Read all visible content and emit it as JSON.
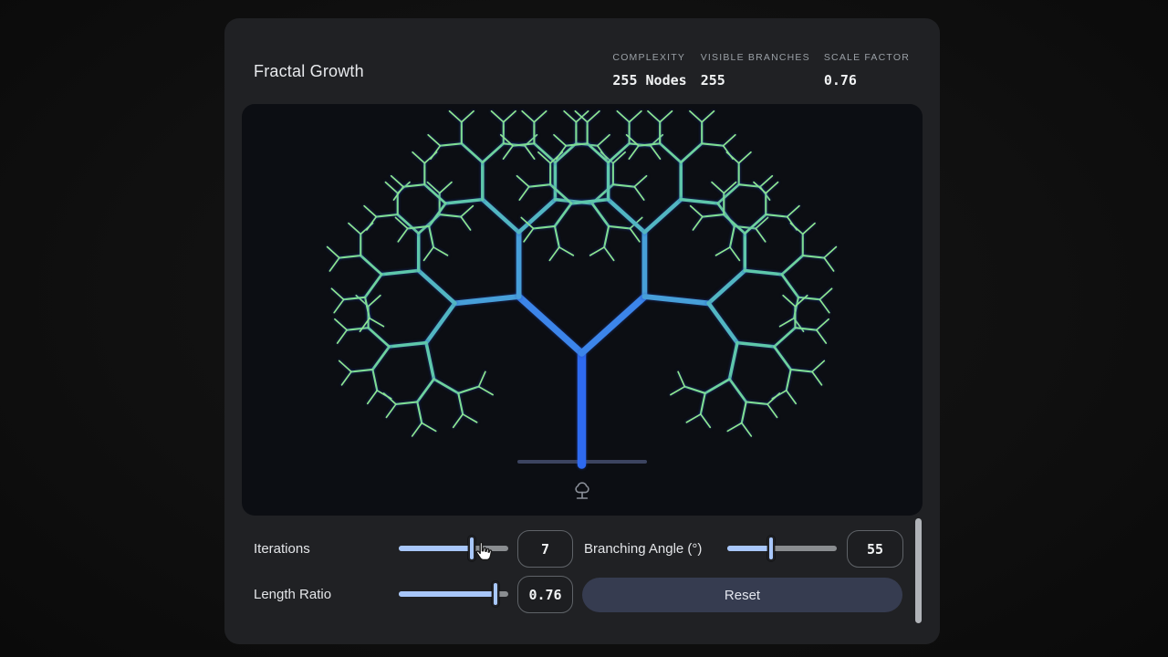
{
  "header": {
    "title": "Fractal Growth",
    "stats": [
      {
        "label": "COMPLEXITY",
        "value": "255 Nodes"
      },
      {
        "label": "VISIBLE BRANCHES",
        "value": "255"
      },
      {
        "label": "SCALE FACTOR",
        "value": "0.76"
      }
    ]
  },
  "tree": {
    "iterations": 7,
    "branching_angle_deg": 55,
    "length_ratio": 0.76,
    "complexity_nodes": 255,
    "visible_branches": 255,
    "scale_factor": 0.76,
    "depth_colors": [
      "#2e6af0",
      "#3c85ea",
      "#479fd9",
      "#52b6c2",
      "#5ec7ab",
      "#6ed29d",
      "#7edd93",
      "#8fe78f"
    ],
    "glow_color": "rgba(37,78,200,0.55)",
    "ground_color": "#3c4460",
    "icon_color": "#8b9099"
  },
  "controls": {
    "iterations": {
      "label": "Iterations",
      "value": "7",
      "fraction": 0.68
    },
    "branching_angle": {
      "label": "Branching Angle (°)",
      "value": "55",
      "fraction": 0.42
    },
    "length_ratio": {
      "label": "Length Ratio",
      "value": "0.76",
      "fraction": 0.9
    },
    "reset_label": "Reset"
  },
  "colors": {
    "card_bg": "#202124",
    "canvas_bg": "#0c0e13",
    "label_gray": "#9aa0a6",
    "text_light": "#e8eaed",
    "slider_fill": "#a8c7fa",
    "slider_track": "#8a8d90",
    "value_border": "#5f6368",
    "reset_bg": "#363c50",
    "scrollbar": "#b0b3b8"
  }
}
